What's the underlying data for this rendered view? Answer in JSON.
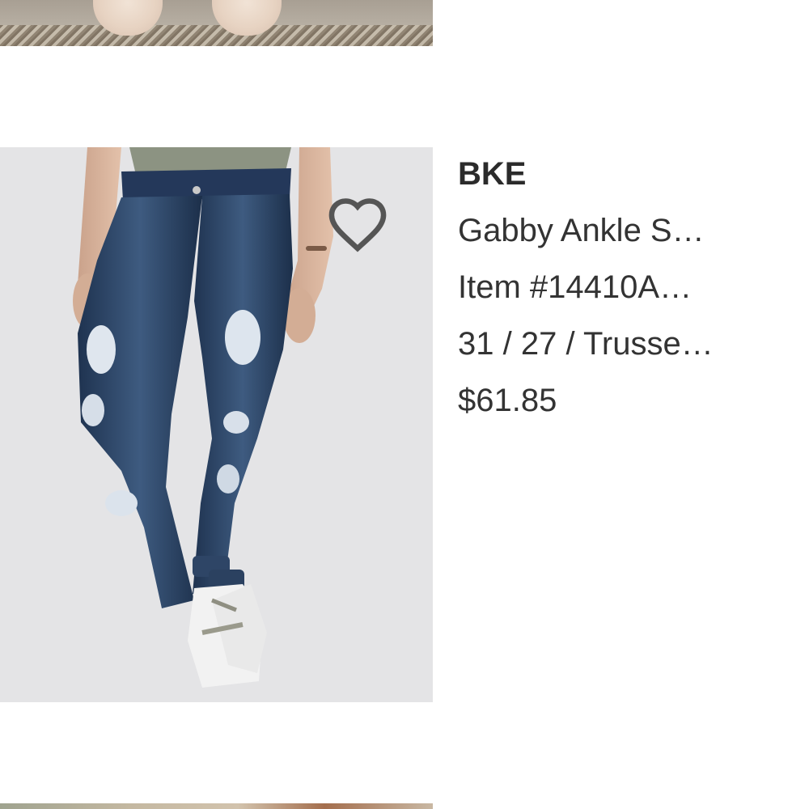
{
  "product": {
    "brand": "BKE",
    "name": "Gabby Ankle S…",
    "item": "Item #14410A…",
    "options": "31 / 27 / Trusse…",
    "price": "$61.85"
  },
  "icons": {
    "favorite": "heart-outline-icon"
  },
  "colors": {
    "icon": "#555555",
    "text": "#333333",
    "background": "#ffffff"
  }
}
